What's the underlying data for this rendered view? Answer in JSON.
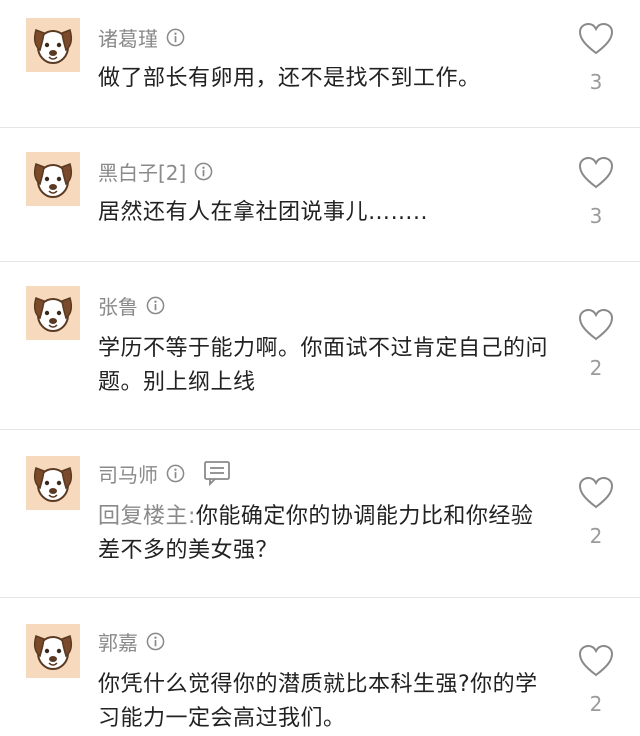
{
  "comments": [
    {
      "author": "诸葛瑾",
      "text": "做了部长有卵用，还不是找不到工作。",
      "likes": "3",
      "has_reply_icon": false
    },
    {
      "author": "黑白子[2]",
      "text": "居然还有人在拿社团说事儿……..",
      "likes": "3",
      "has_reply_icon": false
    },
    {
      "author": "张鲁",
      "text": "学历不等于能力啊。你面试不过肯定自己的问题。别上纲上线",
      "likes": "2",
      "has_reply_icon": false
    },
    {
      "author": "司马师",
      "reply_prefix": "回复楼主:",
      "text": "你能确定你的协调能力比和你经验差不多的美女强？",
      "likes": "2",
      "has_reply_icon": true
    },
    {
      "author": "郭嘉",
      "text": "你凭什么觉得你的潜质就比本科生强?你的学习能力一定会高过我们。",
      "likes": "2",
      "has_reply_icon": false
    }
  ],
  "icons": {
    "avatar": "dog-face-icon",
    "info": "info-circle-icon",
    "like": "heart-outline-icon",
    "reply": "reply-bubble-icon"
  },
  "colors": {
    "avatar_bg": "#f7d9bd",
    "name": "#8a8a8a",
    "text": "#222222",
    "count": "#9a9a9a",
    "divider": "#e6e6e6"
  }
}
